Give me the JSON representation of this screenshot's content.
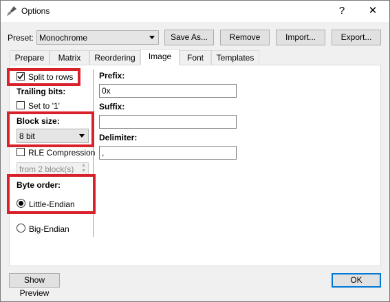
{
  "window": {
    "title": "Options",
    "help_symbol": "?",
    "close_symbol": "✕",
    "icon": "brush-icon"
  },
  "preset": {
    "label": "Preset:",
    "value": "Monochrome",
    "buttons": {
      "save_as": "Save As...",
      "remove": "Remove",
      "import": "Import...",
      "export": "Export..."
    }
  },
  "tabs": [
    "Prepare",
    "Matrix",
    "Reordering",
    "Image",
    "Font",
    "Templates"
  ],
  "active_tab": "Image",
  "left": {
    "split_to_rows": {
      "label": "Split to rows",
      "checked": true
    },
    "trailing_bits": {
      "label": "Trailing bits:"
    },
    "set_to_one": {
      "label": "Set to '1'",
      "checked": false
    },
    "block_size": {
      "label": "Block size:",
      "value": "8 bit"
    },
    "rle_compression": {
      "label": "RLE Compression",
      "checked": false
    },
    "rle_from": {
      "value": "from 2 block(s)"
    },
    "byte_order": {
      "label": "Byte order:"
    },
    "little_endian": {
      "label": "Little-Endian",
      "selected": true
    },
    "big_endian": {
      "label": "Big-Endian",
      "selected": false
    }
  },
  "right": {
    "prefix": {
      "label": "Prefix:",
      "value": "0x"
    },
    "suffix": {
      "label": "Suffix:",
      "value": ""
    },
    "delimiter": {
      "label": "Delimiter:",
      "value": ","
    }
  },
  "footer": {
    "show_preview": "Show Preview",
    "ok": "OK"
  },
  "colors": {
    "highlight": "#d9212b",
    "ok_border": "#0078d7"
  }
}
